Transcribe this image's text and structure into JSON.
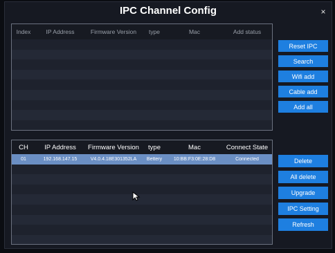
{
  "dialog": {
    "title": "IPC Channel Config",
    "close_glyph": "×"
  },
  "top_table": {
    "headers": [
      "Index",
      "IP Address",
      "Firmware Version",
      "type",
      "Mac",
      "Add status"
    ]
  },
  "bottom_table": {
    "headers": [
      "CH",
      "IP Address",
      "Firmware Version",
      "type",
      "Mac",
      "Connect State"
    ],
    "rows": [
      {
        "ch": "01",
        "ip": "192.168.147.15",
        "firmware": "V4.0.4.18E301352LA",
        "type": "Bettery",
        "mac": "10:BB:F3:0E:28:D8",
        "state": "Connected"
      }
    ]
  },
  "upper_buttons": [
    "Reset IPC",
    "Search",
    "Wifi add",
    "Cable add",
    "Add all"
  ],
  "lower_buttons": [
    "Delete",
    "All delete",
    "Upgrade",
    "IPC Setting",
    "Refresh"
  ],
  "colors": {
    "accent": "#1e7fe0",
    "selected_row": "#6b8fc4"
  }
}
